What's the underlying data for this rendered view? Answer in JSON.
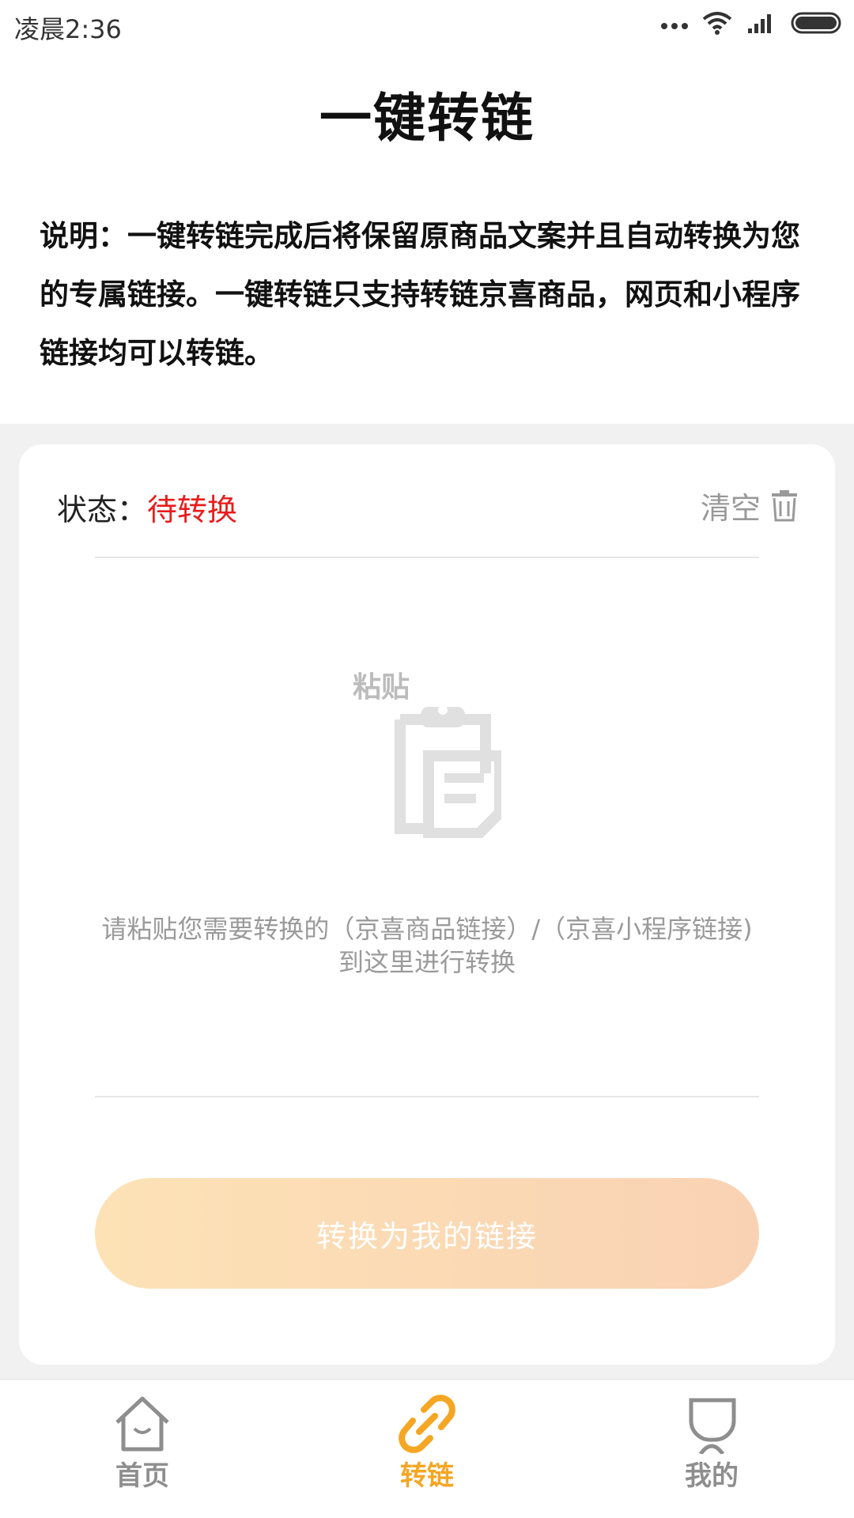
{
  "status_bar": {
    "time": "凌晨2:36"
  },
  "header": {
    "title": "一键转链"
  },
  "description": "说明：一键转链完成后将保留原商品文案并且自动转换为您的专属链接。一键转链只支持转链京喜商品，网页和小程序链接均可以转链。",
  "card": {
    "status_label": "状态：",
    "status_value": "待转换",
    "clear_label": "清空",
    "paste_label": "粘贴",
    "paste_hint": "请粘贴您需要转换的（京喜商品链接）/（京喜小程序链接)到这里进行转换",
    "convert_button": "转换为我的链接"
  },
  "tabs": [
    {
      "label": "首页",
      "icon": "home-icon",
      "active": false
    },
    {
      "label": "转链",
      "icon": "link-icon",
      "active": true
    },
    {
      "label": "我的",
      "icon": "profile-icon",
      "active": false
    }
  ],
  "colors": {
    "status_value": "#e81c1c",
    "active_tab": "#f5a623",
    "inactive_tab": "#8e8e8e",
    "button_gradient_start": "#fde2b6",
    "button_gradient_end": "#f9d2b3"
  }
}
